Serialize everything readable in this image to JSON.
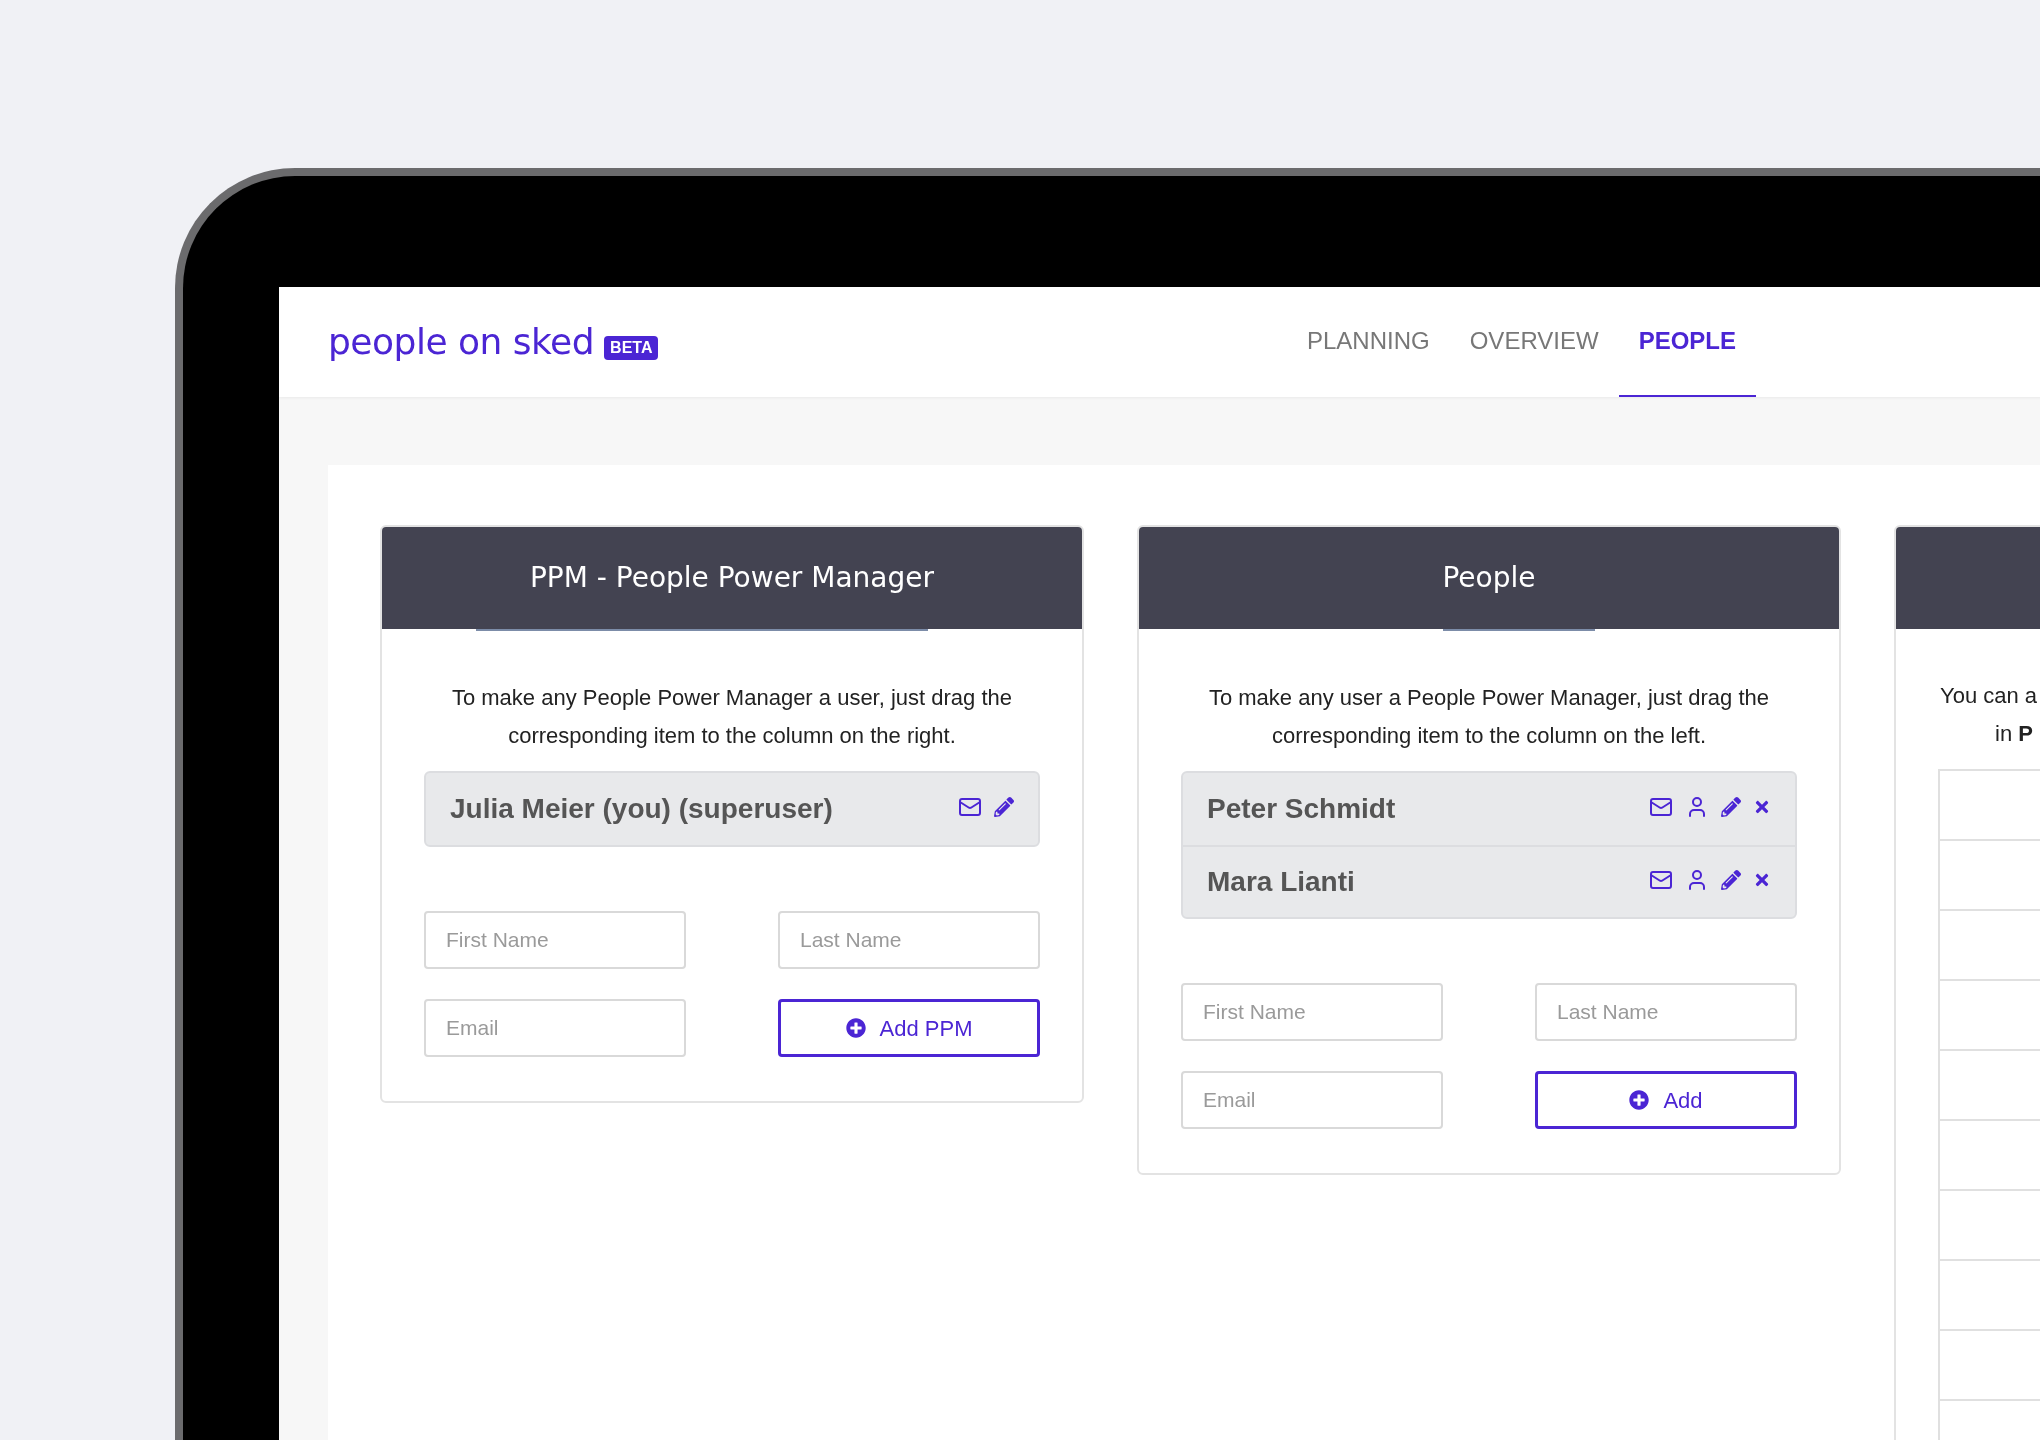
{
  "app": {
    "logo": "people on sked",
    "badge": "BETA"
  },
  "nav": [
    {
      "label": "PLANNING",
      "selected": false
    },
    {
      "label": "OVERVIEW",
      "selected": false
    },
    {
      "label": "PEOPLE",
      "selected": true
    }
  ],
  "columns": [
    {
      "title": "PPM - People Power Manager",
      "description": "To make any People Power Manager a user, just drag the corresponding item to the column on the right.",
      "people": [
        {
          "name": "Julia Meier (you) (superuser)",
          "actions": [
            {
              "kind": "mail"
            },
            {
              "kind": "edit"
            }
          ]
        }
      ],
      "first_name": {
        "placeholder": "First Name"
      },
      "last_name": {
        "placeholder": "Last Name"
      },
      "email": {
        "placeholder": "Email"
      },
      "button": "Add PPM"
    },
    {
      "title": "People",
      "description": "To make any user a People Power Manager, just drag the corresponding item to the column on the left.",
      "people": [
        {
          "name": "Peter Schmidt",
          "actions": [
            {
              "kind": "mail"
            },
            {
              "kind": "user"
            },
            {
              "kind": "edit"
            },
            {
              "kind": "delete"
            }
          ]
        },
        {
          "name": "Mara Lianti",
          "actions": [
            {
              "kind": "mail"
            },
            {
              "kind": "user"
            },
            {
              "kind": "edit"
            },
            {
              "kind": "delete"
            }
          ]
        }
      ],
      "first_name": {
        "placeholder": "First Name"
      },
      "last_name": {
        "placeholder": "Last Name"
      },
      "email": {
        "placeholder": "Email"
      },
      "button": "Add"
    }
  ],
  "column_3": {
    "description_lines": [
      "You can a",
      "in **P**"
    ]
  }
}
